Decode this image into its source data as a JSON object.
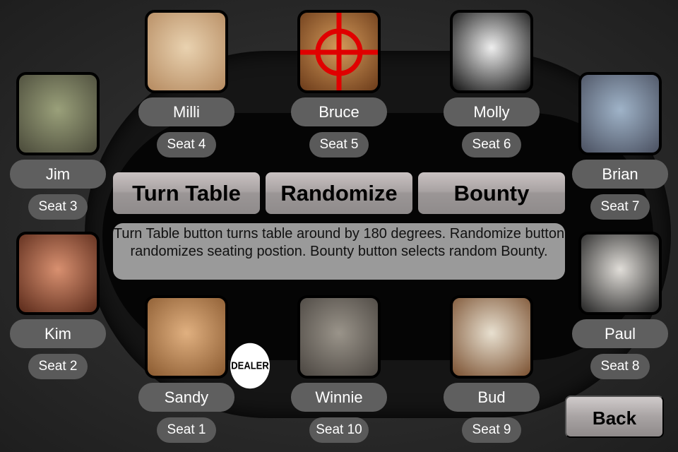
{
  "players": [
    {
      "name": "Milli",
      "seat": "Seat 4",
      "photo": "dog-white-fluffy",
      "colors": [
        "#e9d2b0",
        "#b58a60"
      ]
    },
    {
      "name": "Bruce",
      "seat": "Seat 5",
      "photo": "guinea-pig",
      "colors": [
        "#d49a5a",
        "#6b3b1a"
      ],
      "bounty": true
    },
    {
      "name": "Molly",
      "seat": "Seat 6",
      "photo": "dog-black-white",
      "colors": [
        "#eee",
        "#111"
      ]
    },
    {
      "name": "Jim",
      "seat": "Seat 3",
      "photo": "duck",
      "colors": [
        "#9aa07a",
        "#4a4a3a"
      ]
    },
    {
      "name": "Brian",
      "seat": "Seat 7",
      "photo": "lizard",
      "colors": [
        "#9fb3c8",
        "#4a5060"
      ]
    },
    {
      "name": "Kim",
      "seat": "Seat 2",
      "photo": "woman",
      "colors": [
        "#d89070",
        "#5a2a1a"
      ]
    },
    {
      "name": "Paul",
      "seat": "Seat 8",
      "photo": "man-beanie",
      "colors": [
        "#e0ddd8",
        "#222"
      ]
    },
    {
      "name": "Sandy",
      "seat": "Seat 1",
      "photo": "dog-tan",
      "colors": [
        "#e0b080",
        "#8a5a30"
      ]
    },
    {
      "name": "Winnie",
      "seat": "Seat 10",
      "photo": "tabby-cat",
      "colors": [
        "#9a948a",
        "#4a4540"
      ]
    },
    {
      "name": "Bud",
      "seat": "Seat 9",
      "photo": "dog-beagle",
      "colors": [
        "#e8e0d0",
        "#7a5030"
      ]
    }
  ],
  "buttons": {
    "turn_table": "Turn Table",
    "randomize": "Randomize",
    "bounty": "Bounty",
    "back": "Back"
  },
  "info": "Turn Table button turns table around by 180 degrees. Randomize button randomizes seating postion. Bounty button selects random Bounty.",
  "dealer": "DEALER",
  "bounty_color": "#e00000"
}
